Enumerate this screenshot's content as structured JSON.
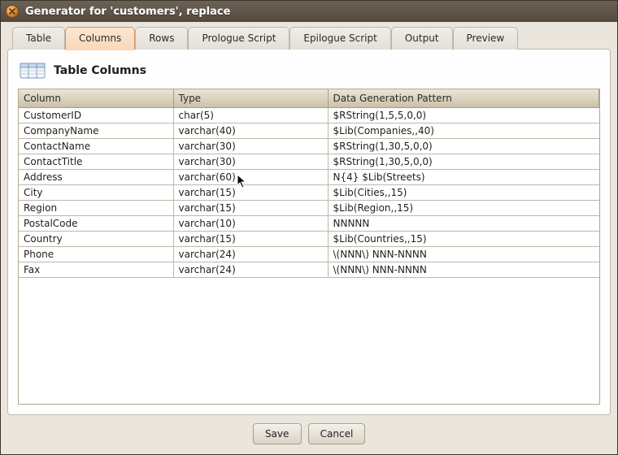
{
  "window": {
    "title": "Generator for 'customers', replace"
  },
  "tabs": {
    "items": [
      {
        "label": "Table"
      },
      {
        "label": "Columns"
      },
      {
        "label": "Rows"
      },
      {
        "label": "Prologue Script"
      },
      {
        "label": "Epilogue Script"
      },
      {
        "label": "Output"
      },
      {
        "label": "Preview"
      }
    ],
    "active_index": 1
  },
  "panel": {
    "title": "Table Columns"
  },
  "table": {
    "headers": {
      "col": "Column",
      "type": "Type",
      "pattern": "Data Generation Pattern"
    },
    "rows": [
      {
        "col": "CustomerID",
        "type": "char(5)",
        "pattern": "$RString(1,5,5,0,0)"
      },
      {
        "col": "CompanyName",
        "type": "varchar(40)",
        "pattern": "$Lib(Companies,,40)"
      },
      {
        "col": "ContactName",
        "type": "varchar(30)",
        "pattern": "$RString(1,30,5,0,0)"
      },
      {
        "col": "ContactTitle",
        "type": "varchar(30)",
        "pattern": "$RString(1,30,5,0,0)"
      },
      {
        "col": "Address",
        "type": "varchar(60)",
        "pattern": "N{4} $Lib(Streets)"
      },
      {
        "col": "City",
        "type": "varchar(15)",
        "pattern": "$Lib(Cities,,15)"
      },
      {
        "col": "Region",
        "type": "varchar(15)",
        "pattern": "$Lib(Region,,15)"
      },
      {
        "col": "PostalCode",
        "type": "varchar(10)",
        "pattern": "NNNNN"
      },
      {
        "col": "Country",
        "type": "varchar(15)",
        "pattern": "$Lib(Countries,,15)"
      },
      {
        "col": "Phone",
        "type": "varchar(24)",
        "pattern": "\\(NNN\\) NNN-NNNN"
      },
      {
        "col": "Fax",
        "type": "varchar(24)",
        "pattern": "\\(NNN\\) NNN-NNNN"
      }
    ]
  },
  "buttons": {
    "save": "Save",
    "cancel": "Cancel"
  }
}
